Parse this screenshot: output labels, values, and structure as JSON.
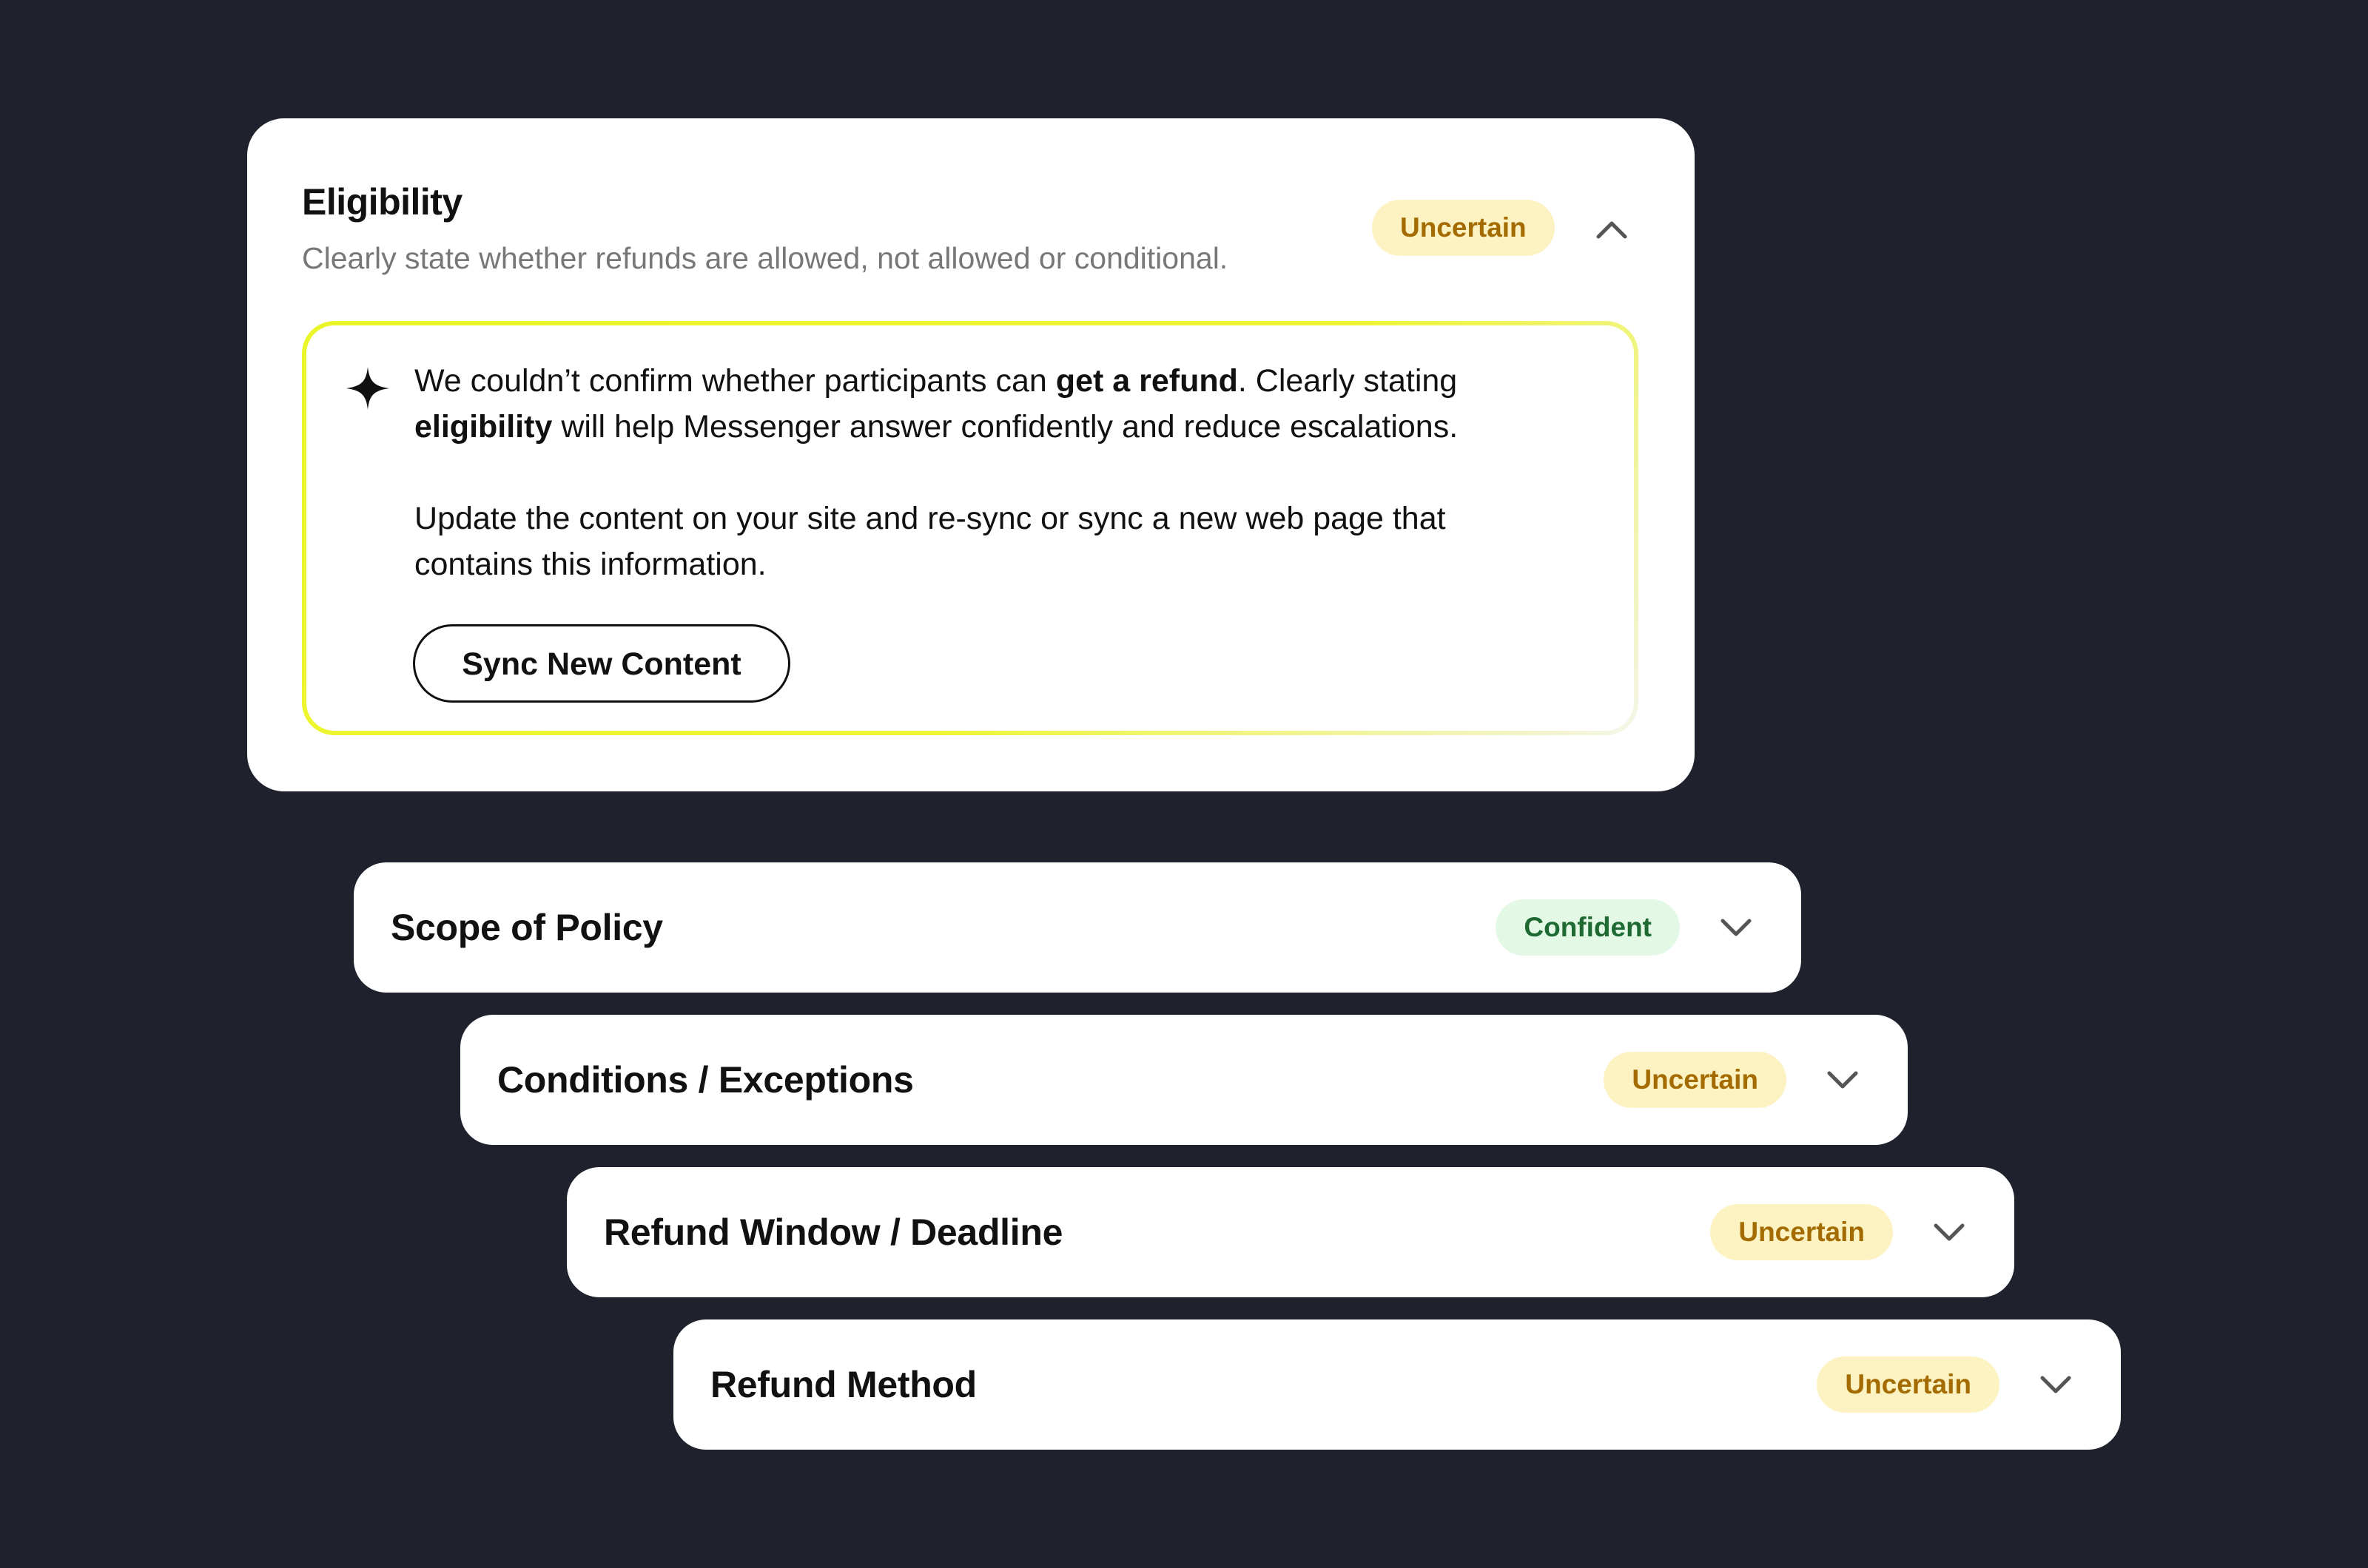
{
  "expanded": {
    "title": "Eligibility",
    "subtitle": "Clearly state whether refunds are allowed, not allowed or conditional.",
    "badge": "Uncertain",
    "toggle_icon": "chevron-up-icon",
    "insight": {
      "icon": "sparkle-icon",
      "p1_a": "We couldn’t confirm whether participants can ",
      "p1_b": "get a refund",
      "p1_c": ". Clearly stating ",
      "p1_d": "eligibility",
      "p1_e": " will help Messenger answer confidently and reduce escalations.",
      "p2": "Update the content on your site and re-sync or sync a new web page that contains this information.",
      "button": "Sync New Content"
    }
  },
  "sections": [
    {
      "title": "Scope of Policy",
      "badge": "Confident",
      "status": "confident",
      "toggle_icon": "chevron-down-icon"
    },
    {
      "title": "Conditions / Exceptions",
      "badge": "Uncertain",
      "status": "uncertain",
      "toggle_icon": "chevron-down-icon"
    },
    {
      "title": "Refund Window / Deadline",
      "badge": "Uncertain",
      "status": "uncertain",
      "toggle_icon": "chevron-down-icon"
    },
    {
      "title": "Refund Method",
      "badge": "Uncertain",
      "status": "uncertain",
      "toggle_icon": "chevron-down-icon"
    }
  ],
  "colors": {
    "background": "#1f212d",
    "card": "#ffffff",
    "uncertain_bg": "#fdf2c2",
    "uncertain_text": "#a46c00",
    "confident_bg": "#e4f8e6",
    "confident_text": "#1e6a32",
    "highlight_border": "#eaf52a"
  }
}
